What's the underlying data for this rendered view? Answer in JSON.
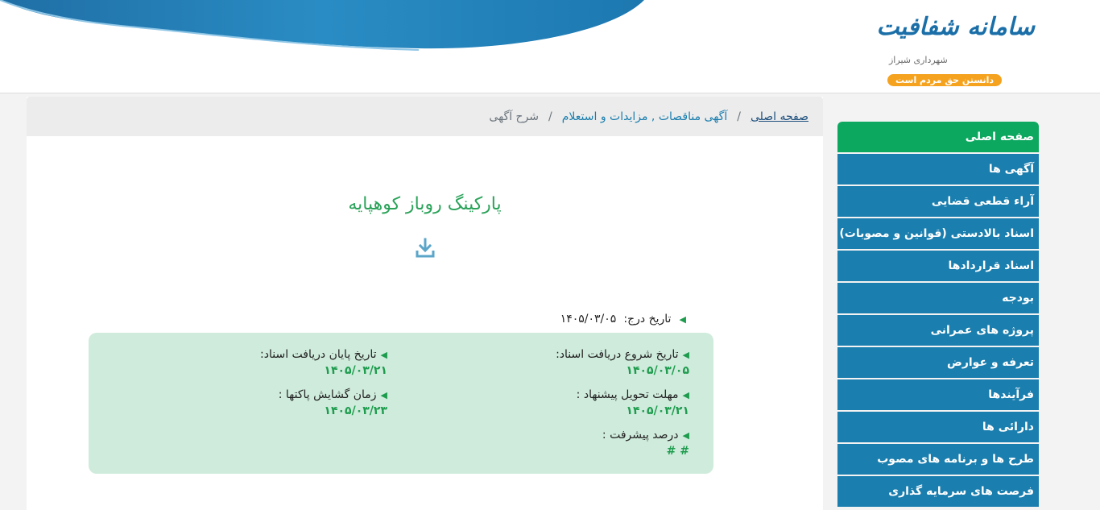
{
  "header": {
    "logo_title": "سامانه شفافیت",
    "logo_subtitle": "شهرداری شیراز",
    "logo_tagline": "دانستن حق مردم است",
    "wave_color": "#1a7eae"
  },
  "breadcrumb": {
    "home": "صفحه اصلی",
    "section": "آگهی مناقصات , مزایدات و استعلام",
    "current": "شرح آگهی",
    "separator": "/"
  },
  "sidebar": {
    "items": [
      {
        "label": "صفحه اصلی",
        "active": true
      },
      {
        "label": "آگهی ها"
      },
      {
        "label": "آراء قطعی قضایی"
      },
      {
        "label": "اسناد بالادستی (قوانین و مصوبات)"
      },
      {
        "label": "اسناد قراردادها"
      },
      {
        "label": "بودجه"
      },
      {
        "label": "پروژه های عمرانی"
      },
      {
        "label": "تعرفه و عوارض"
      },
      {
        "label": "فرآیندها"
      },
      {
        "label": "دارائی ها"
      },
      {
        "label": "طرح ها و برنامه های مصوب"
      },
      {
        "label": "فرصت های سرمایه گذاری"
      }
    ],
    "active_color": "#0da860",
    "item_color": "#1a7eae"
  },
  "notice": {
    "title": "پارکینگ روباز کوهپایه",
    "download_icon": "download-icon",
    "posted_label": "تاریخ درج:",
    "posted_value": "۱۴۰۵/۰۳/۰۵",
    "start_label": "تاریخ شروع دریافت اسناد:",
    "start_value": "۱۴۰۵/۰۳/۰۵",
    "end_label": "تاریخ پایان دریافت اسناد:",
    "end_value": "۱۴۰۵/۰۳/۲۱",
    "deadline_label": "مهلت تحویل پیشنهاد :",
    "deadline_value": "۱۴۰۵/۰۳/۲۱",
    "opening_label": "زمان گشایش پاکتها :",
    "opening_value": "۱۴۰۵/۰۳/۲۳",
    "progress_label": "درصد پیشرفت :",
    "progress_value": "# #"
  }
}
